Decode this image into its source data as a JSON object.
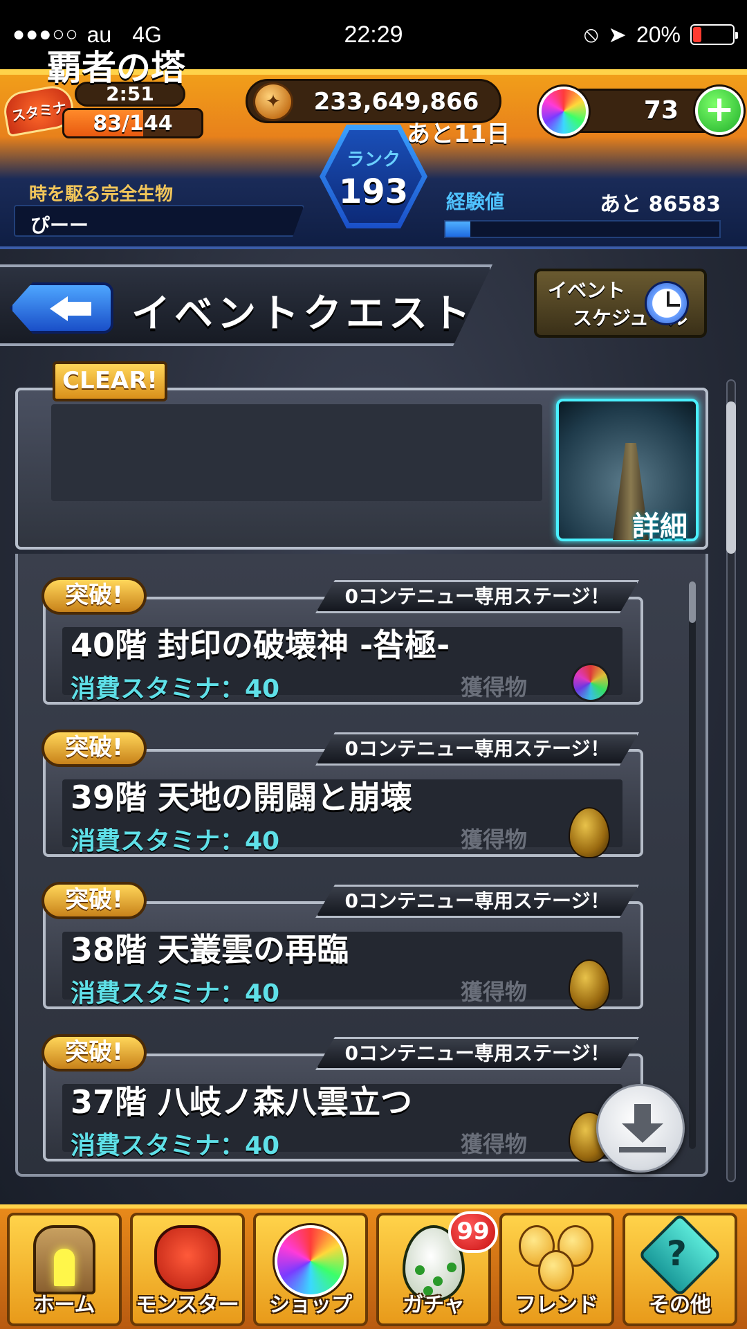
{
  "status_bar": {
    "signal": "●●●○○",
    "carrier": "au",
    "network": "4G",
    "time": "22:29",
    "battery": "20%",
    "battery_level": 0.2,
    "lock_rotation_icon": "⦸",
    "location_icon": "➤"
  },
  "header": {
    "stamina_label": "スタミナ",
    "stamina_timer": "2:51",
    "stamina_value": "83/144",
    "stamina_level": 0.576,
    "coin_value": "233,649,866",
    "orb_value": "73",
    "rank_label": "ランク",
    "rank_value": "193",
    "title": "時を駆る完全生物",
    "player_name": "ぴーー",
    "exp_label": "経験値",
    "exp_remaining": "あと 86583",
    "exp_level": 0.09
  },
  "page": {
    "title": "イベントクエスト",
    "schedule_line1": "イベント",
    "schedule_line2": "スケジュール"
  },
  "event": {
    "clear_badge": "CLEAR!",
    "name": "覇者の塔",
    "remaining": "あと11日",
    "detail_label": "詳細"
  },
  "quests": [
    {
      "badge": "突破!",
      "tag": "0コンテニュー専用ステージ！",
      "name": "40階 封印の破壊神 -咎極-",
      "stamina": "消費スタミナ：40",
      "reward_label": "獲得物",
      "reward": "orb"
    },
    {
      "badge": "突破!",
      "tag": "0コンテニュー専用ステージ！",
      "name": "39階 天地の開闢と崩壊",
      "stamina": "消費スタミナ：40",
      "reward_label": "獲得物",
      "reward": "egg"
    },
    {
      "badge": "突破!",
      "tag": "0コンテニュー専用ステージ！",
      "name": "38階 天叢雲の再臨",
      "stamina": "消費スタミナ：40",
      "reward_label": "獲得物",
      "reward": "egg"
    },
    {
      "badge": "突破!",
      "tag": "0コンテニュー専用ステージ！",
      "name": "37階 八岐ノ森八雲立つ",
      "stamina": "消費スタミナ：40",
      "reward_label": "獲得物",
      "reward": "egg"
    }
  ],
  "nav": {
    "home": "ホーム",
    "monster": "モンスター",
    "shop": "ショップ",
    "gacha": "ガチャ",
    "gacha_badge": "99",
    "friend": "フレンド",
    "other": "その他"
  },
  "colors": {
    "header_orange": "#e8811b",
    "header_navy": "#0f1e44",
    "accent_cyan": "#5fe0e8",
    "badge_gold": "#ffd65a"
  }
}
